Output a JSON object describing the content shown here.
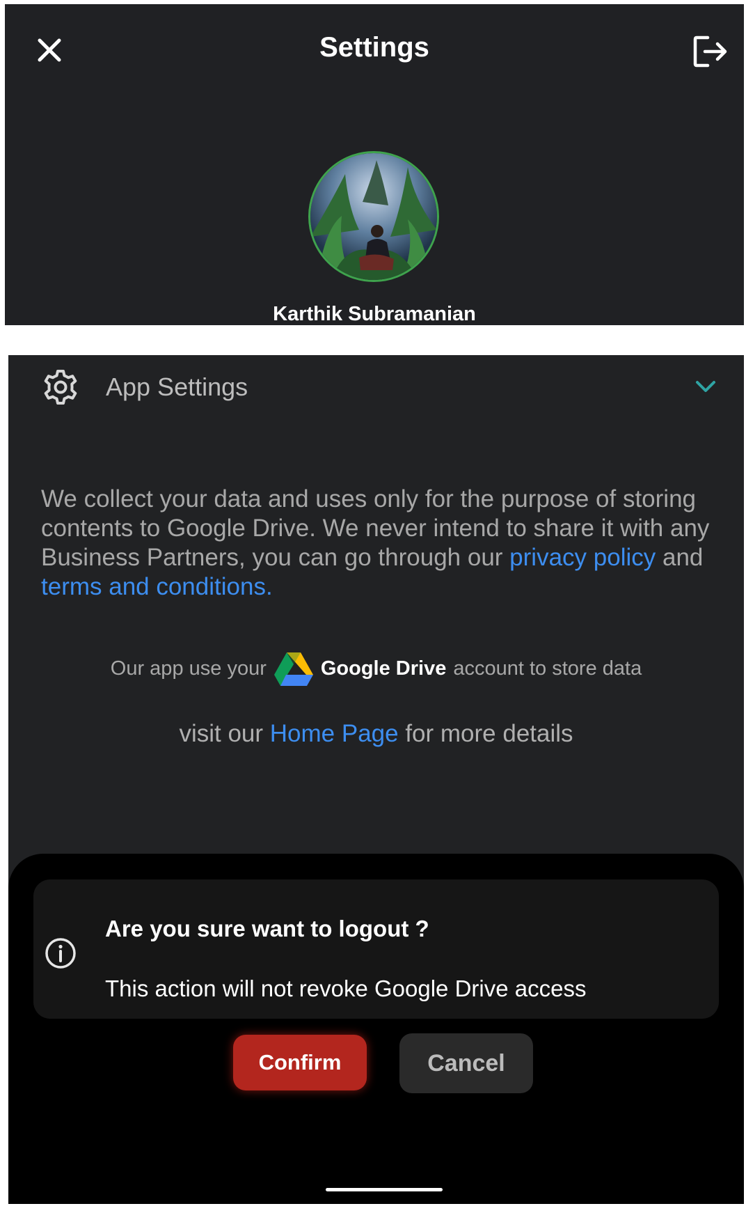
{
  "header": {
    "title": "Settings",
    "close_icon": "close-icon",
    "logout_icon": "logout-icon",
    "user_name": "Karthik Subramanian"
  },
  "app_settings": {
    "label": "App Settings",
    "icon": "gear-icon",
    "expand_icon": "chevron-down-icon",
    "accent_color": "#2fa4a4"
  },
  "privacy": {
    "text_before": "We collect your data and uses only for the purpose of storing contents to Google Drive. We never intend to share it with any Business Partners, you can go through our ",
    "privacy_link": "privacy policy",
    "text_between": " and ",
    "terms_link": "terms and conditions.",
    "link_color": "#3d8ef0"
  },
  "drive_info": {
    "prefix": "Our app use your",
    "drive_name": "Google Drive",
    "suffix": "account to store data",
    "icon": "google-drive-icon"
  },
  "visit": {
    "prefix": "visit our ",
    "link": "Home Page",
    "suffix": " for more details"
  },
  "logout_dialog": {
    "icon": "info-icon",
    "title": "Are you sure want to logout ?",
    "message": "This action will not revoke Google Drive access",
    "confirm_label": "Confirm",
    "cancel_label": "Cancel",
    "confirm_color": "#b3261e"
  }
}
